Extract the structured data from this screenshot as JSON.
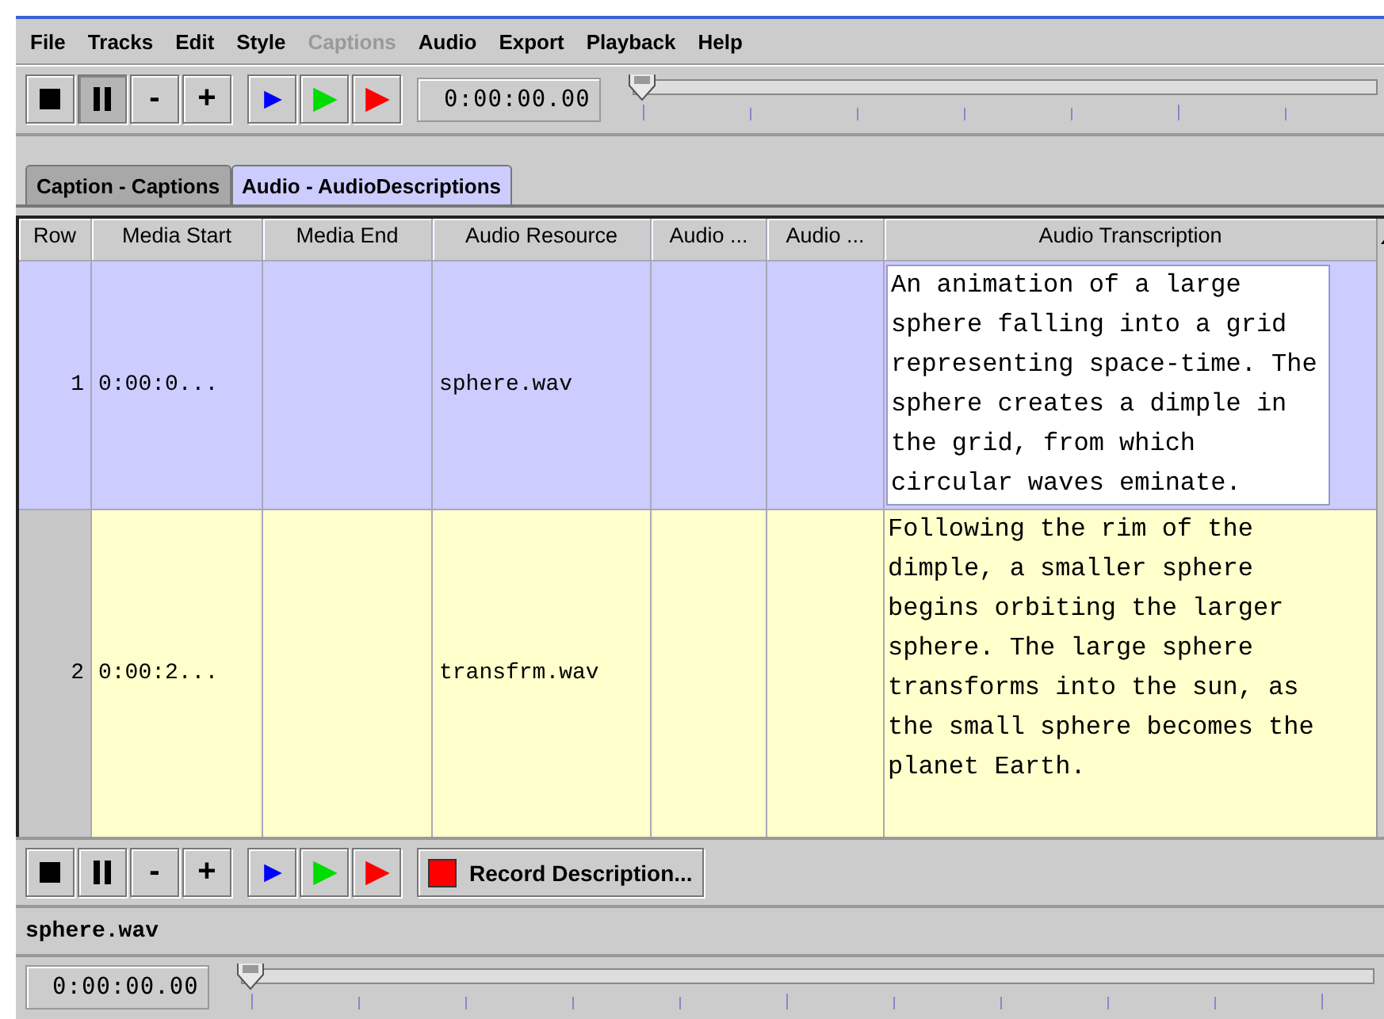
{
  "menu": [
    {
      "label": "File",
      "disabled": false
    },
    {
      "label": "Tracks",
      "disabled": false
    },
    {
      "label": "Edit",
      "disabled": false
    },
    {
      "label": "Style",
      "disabled": false
    },
    {
      "label": "Captions",
      "disabled": true
    },
    {
      "label": "Audio",
      "disabled": false
    },
    {
      "label": "Export",
      "disabled": false
    },
    {
      "label": "Playback",
      "disabled": false
    },
    {
      "label": "Help",
      "disabled": false
    }
  ],
  "toolbar": {
    "buttons": [
      {
        "kind": "stop",
        "pressed": false
      },
      {
        "kind": "pause",
        "pressed": true
      },
      {
        "kind": "text",
        "label": "-",
        "pressed": false
      },
      {
        "kind": "text",
        "label": "+",
        "pressed": false
      },
      {
        "kind": "play",
        "color": "#0000ff",
        "pressed": false
      },
      {
        "kind": "play",
        "color": "#00dd00",
        "pressed": false
      },
      {
        "kind": "play",
        "color": "#ff0000",
        "pressed": false
      }
    ],
    "time": "0:00:00.00",
    "slider": {
      "level": 0
    }
  },
  "tabs": [
    {
      "label": "Caption - Captions",
      "selected": false
    },
    {
      "label": "Audio - AudioDescriptions",
      "selected": true
    }
  ],
  "table": {
    "columns": [
      "Row",
      "Media Start",
      "Media End",
      "Audio Resource",
      "Audio ...",
      "Audio ...",
      "Audio Transcription"
    ],
    "rows": [
      {
        "selected": true,
        "row": "1",
        "media_start": "0:00:0...",
        "audio_resource": "sphere.wav",
        "audio_transcription": "An animation of a large sphere falling into a grid representing space-time. The sphere creates a dimple in the grid, from which circular waves eminate."
      },
      {
        "selected": false,
        "row": "2",
        "media_start": "0:00:2...",
        "audio_resource": "transfrm.wav",
        "audio_transcription": "Following the rim of the dimple, a smaller sphere begins orbiting the larger sphere. The large sphere transforms into the sun, as the small sphere becomes the planet Earth."
      }
    ]
  },
  "player": {
    "buttons": [
      {
        "kind": "stop",
        "pressed": false
      },
      {
        "kind": "pause",
        "pressed": false
      },
      {
        "kind": "text",
        "label": "-",
        "pressed": false
      },
      {
        "kind": "text",
        "label": "+",
        "pressed": false
      },
      {
        "kind": "play",
        "color": "#0000ff",
        "pressed": false
      },
      {
        "kind": "play",
        "color": "#00dd00",
        "pressed": false
      },
      {
        "kind": "play",
        "color": "#ff0000",
        "pressed": false
      }
    ],
    "record_button": "Record Description...",
    "file": "sphere.wav",
    "time": "0:00:00.00",
    "slider": {
      "level": 0
    }
  }
}
